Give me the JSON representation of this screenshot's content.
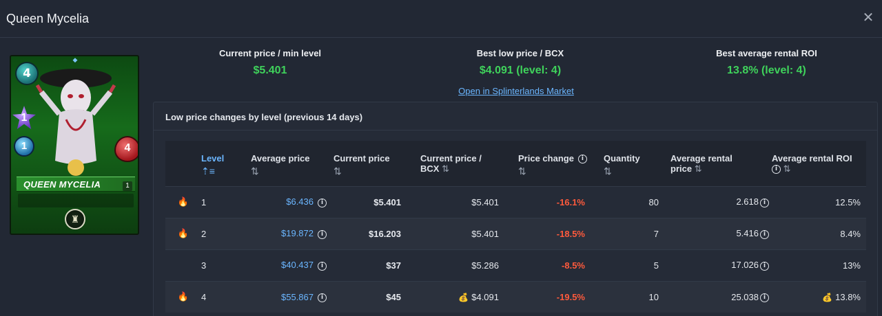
{
  "window": {
    "title": "Queen Mycelia",
    "close_icon": "close-icon"
  },
  "card": {
    "name": "QUEEN MYCELIA",
    "mana": "4",
    "magic": "1",
    "speed": "1",
    "health": "4",
    "level": "1",
    "colors": {
      "frame": "#166b1b",
      "mana": "#1b6f74",
      "magic": "#6a38c4",
      "speed": "#1f6fa8",
      "health": "#a3161c"
    }
  },
  "summary": {
    "current": {
      "label": "Current price / min level",
      "value": "$5.401"
    },
    "best_low": {
      "label": "Best low price / BCX",
      "value": "$4.091 (level: 4)"
    },
    "best_roi": {
      "label": "Best average rental ROI",
      "value": "13.8% (level: 4)"
    },
    "market_link": "Open in Splinterlands Market"
  },
  "panel": {
    "title": "Low price changes by level (previous 14 days)",
    "headers": {
      "level": "Level",
      "avg_price": "Average price",
      "current_price": "Current price",
      "current_bcx_1": "Current price /",
      "current_bcx_2": "BCX",
      "price_change": "Price change",
      "quantity": "Quantity",
      "avg_rental_1": "Average rental",
      "avg_rental_2": "price",
      "avg_roi": "Average rental ROI"
    },
    "rows": [
      {
        "fire": true,
        "level": "1",
        "avg_price": "$6.436",
        "current_price": "$5.401",
        "bcx": "$5.401",
        "bcx_best": false,
        "change": "-16.1%",
        "quantity": "80",
        "rental": "2.618",
        "roi": "12.5%",
        "roi_best": false
      },
      {
        "fire": true,
        "level": "2",
        "avg_price": "$19.872",
        "current_price": "$16.203",
        "bcx": "$5.401",
        "bcx_best": false,
        "change": "-18.5%",
        "quantity": "7",
        "rental": "5.416",
        "roi": "8.4%",
        "roi_best": false
      },
      {
        "fire": false,
        "level": "3",
        "avg_price": "$40.437",
        "current_price": "$37",
        "bcx": "$5.286",
        "bcx_best": false,
        "change": "-8.5%",
        "quantity": "5",
        "rental": "17.026",
        "roi": "13%",
        "roi_best": false
      },
      {
        "fire": true,
        "level": "4",
        "avg_price": "$55.867",
        "current_price": "$45",
        "bcx": "$4.091",
        "bcx_best": true,
        "change": "-19.5%",
        "quantity": "10",
        "rental": "25.038",
        "roi": "13.8%",
        "roi_best": true
      }
    ]
  },
  "accent_colors": {
    "positive": "#3fd25b",
    "negative": "#ff5a3c",
    "link": "#6bb6ff"
  }
}
